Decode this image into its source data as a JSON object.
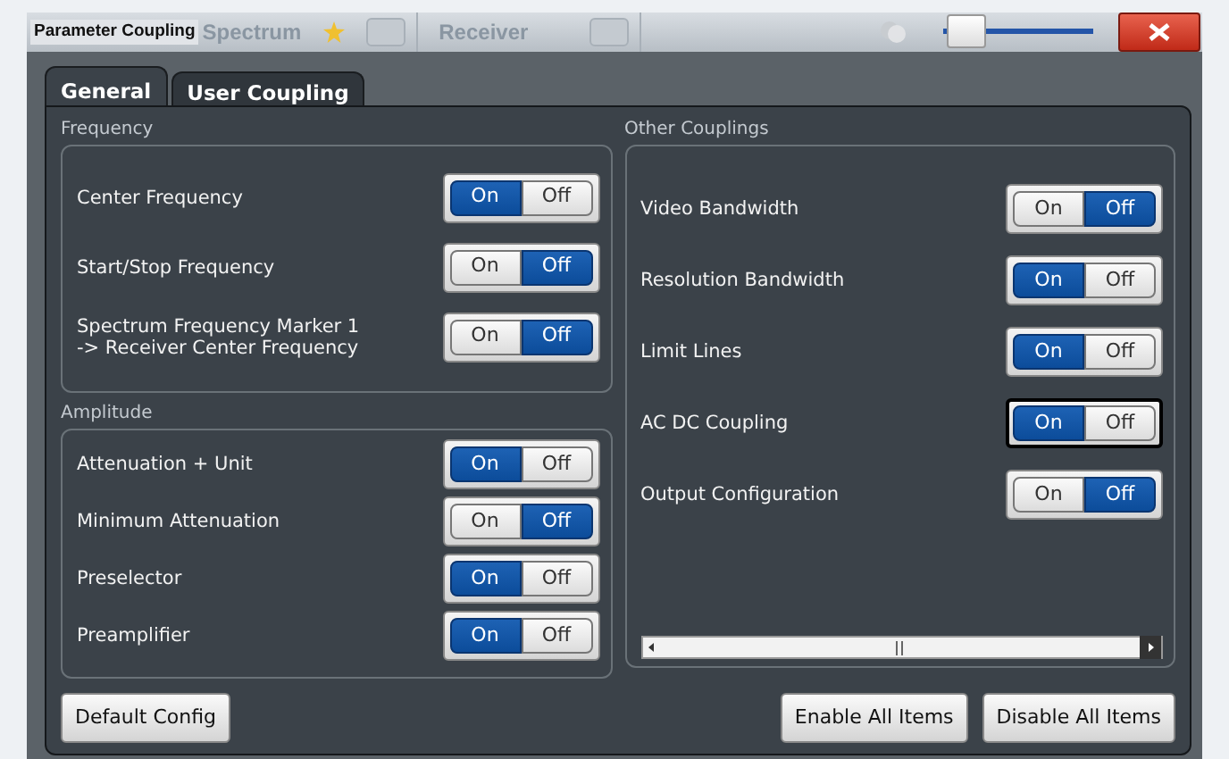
{
  "title_bar": {
    "dialog_title": "Parameter Coupling",
    "tabs": [
      {
        "label": "Spectrum",
        "starred": true
      },
      {
        "label": "Receiver",
        "starred": false
      }
    ],
    "transparency": {
      "level": 0.05
    }
  },
  "tabs": [
    {
      "label": "General",
      "selected": true
    },
    {
      "label": "User Coupling",
      "selected": false
    }
  ],
  "left_groups": [
    {
      "title": "Frequency",
      "items": [
        {
          "label": "Center Frequency",
          "on": true,
          "focused": false,
          "on_text": "On",
          "off_text": "Off"
        },
        {
          "label": "Start/Stop Frequency",
          "on": false,
          "focused": false,
          "on_text": "On",
          "off_text": "Off"
        },
        {
          "label": "Spectrum Frequency Marker 1\n-> Receiver Center Frequency",
          "on": false,
          "focused": false,
          "on_text": "On",
          "off_text": "Off"
        }
      ]
    },
    {
      "title": "Amplitude",
      "items": [
        {
          "label": "Attenuation + Unit",
          "on": true,
          "focused": false,
          "on_text": "On",
          "off_text": "Off"
        },
        {
          "label": "Minimum Attenuation",
          "on": false,
          "focused": false,
          "on_text": "On",
          "off_text": "Off"
        },
        {
          "label": "Preselector",
          "on": true,
          "focused": false,
          "on_text": "On",
          "off_text": "Off"
        },
        {
          "label": "Preamplifier",
          "on": true,
          "focused": false,
          "on_text": "On",
          "off_text": "Off"
        }
      ]
    }
  ],
  "right_group": {
    "title": "Other Couplings",
    "items": [
      {
        "label": "Video Bandwidth",
        "on": false,
        "focused": false,
        "on_text": "On",
        "off_text": "Off"
      },
      {
        "label": "Resolution Bandwidth",
        "on": true,
        "focused": false,
        "on_text": "On",
        "off_text": "Off"
      },
      {
        "label": "Limit Lines",
        "on": true,
        "focused": false,
        "on_text": "On",
        "off_text": "Off"
      },
      {
        "label": "AC DC Coupling",
        "on": true,
        "focused": true,
        "on_text": "On",
        "off_text": "Off"
      },
      {
        "label": "Output Configuration",
        "on": false,
        "focused": false,
        "on_text": "On",
        "off_text": "Off"
      }
    ]
  },
  "buttons_left": [
    "Default Config"
  ],
  "buttons_right": [
    "Enable All Items",
    "Disable All Items"
  ]
}
